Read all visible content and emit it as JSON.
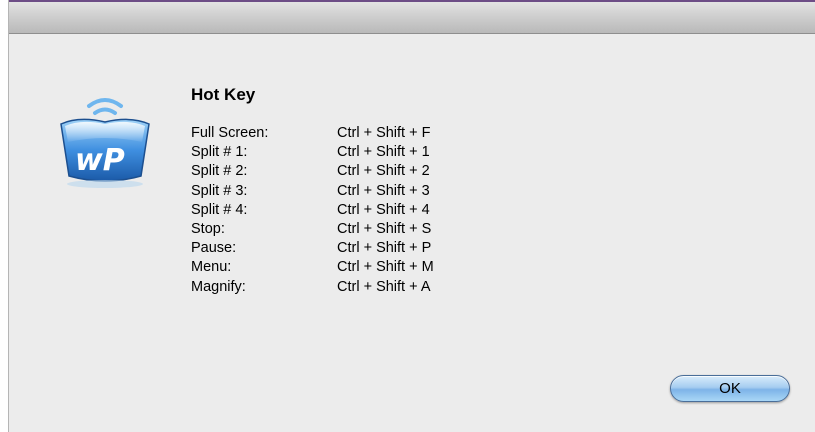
{
  "dialog": {
    "heading": "Hot Key",
    "ok_label": "OK",
    "icon": "wp-logo-icon"
  },
  "hotkeys": [
    {
      "action": "Full Screen:",
      "keys": "Ctrl + Shift + F"
    },
    {
      "action": "Split # 1:",
      "keys": "Ctrl + Shift + 1"
    },
    {
      "action": "Split # 2:",
      "keys": "Ctrl + Shift + 2"
    },
    {
      "action": "Split # 3:",
      "keys": "Ctrl + Shift + 3"
    },
    {
      "action": "Split # 4:",
      "keys": "Ctrl + Shift + 4"
    },
    {
      "action": "Stop:",
      "keys": "Ctrl + Shift + S"
    },
    {
      "action": "Pause:",
      "keys": "Ctrl + Shift + P"
    },
    {
      "action": "Menu:",
      "keys": "Ctrl + Shift + M"
    },
    {
      "action": "Magnify:",
      "keys": "Ctrl + Shift + A"
    }
  ],
  "logo": {
    "text": "wP",
    "colors": {
      "primary": "#2f7fd8",
      "light": "#8fc7f4",
      "dark": "#1a4f9c"
    }
  }
}
